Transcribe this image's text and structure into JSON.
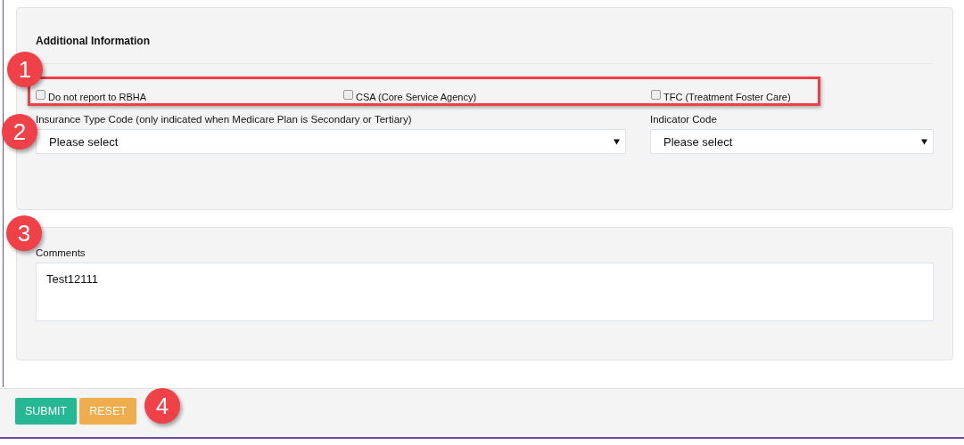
{
  "panel": {
    "title": "Additional Information",
    "checkboxes": [
      {
        "label": "Do not report to RBHA",
        "checked": false
      },
      {
        "label": "CSA (Core Service Agency)",
        "checked": false
      },
      {
        "label": "TFC (Treatment Foster Care)",
        "checked": false
      }
    ],
    "selects": [
      {
        "label": "Insurance Type Code (only indicated when Medicare Plan is Secondary or Tertiary)",
        "value": "Please select"
      },
      {
        "label": "Indicator Code",
        "value": "Please select"
      }
    ]
  },
  "comments": {
    "label": "Comments",
    "value": "Test12111"
  },
  "buttons": [
    {
      "label": "SUBMIT",
      "kind": "primary"
    },
    {
      "label": "RESET",
      "kind": "warning"
    }
  ],
  "callouts": [
    "1",
    "2",
    "3",
    "4"
  ]
}
